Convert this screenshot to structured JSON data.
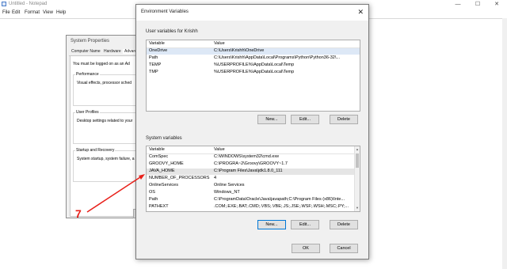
{
  "notepad": {
    "title": "Untitled - Notepad",
    "menu": [
      "File",
      "Edit",
      "Format",
      "View",
      "Help"
    ]
  },
  "system_properties": {
    "title": "System Properties",
    "tabs": [
      "Computer Name",
      "Hardware",
      "Advan"
    ],
    "note": "You must be logged on as an Ad",
    "groups": [
      {
        "heading": "Performance",
        "desc": "Visual effects, processor sched"
      },
      {
        "heading": "User Profiles",
        "desc": "Desktop settings related to your"
      },
      {
        "heading": "Startup and Recovery",
        "desc": "System startup, system failure, a"
      }
    ],
    "ok": "OK"
  },
  "env": {
    "title": "Environment Variables",
    "close": "✕",
    "user_label": "User variables for Krishh",
    "columns": [
      "Variable",
      "Value"
    ],
    "user_rows": [
      {
        "var": "OneDrive",
        "val": "C:\\Users\\Krishh\\OneDrive"
      },
      {
        "var": "Path",
        "val": "C:\\Users\\Krishh\\AppData\\Local\\Programs\\Python\\Python36-32\\..."
      },
      {
        "var": "TEMP",
        "val": "%USERPROFILE%\\AppData\\Local\\Temp"
      },
      {
        "var": "TMP",
        "val": "%USERPROFILE%\\AppData\\Local\\Temp"
      }
    ],
    "user_buttons": [
      "New...",
      "Edit...",
      "Delete"
    ],
    "system_label": "System variables",
    "system_rows": [
      {
        "var": "ComSpec",
        "val": "C:\\WINDOWS\\system32\\cmd.exe"
      },
      {
        "var": "GROOVY_HOME",
        "val": "C:\\PROGRA~2\\Groovy\\GROOVY~1.7"
      },
      {
        "var": "JAVA_HOME",
        "val": "C:\\Program Files\\Java\\jdk1.8.0_111"
      },
      {
        "var": "NUMBER_OF_PROCESSORS",
        "val": "4"
      },
      {
        "var": "OnlineServices",
        "val": "Online Services"
      },
      {
        "var": "OS",
        "val": "Windows_NT"
      },
      {
        "var": "Path",
        "val": "C:\\ProgramData\\Oracle\\Java\\javapath;C:\\Program Files (x86)\\Inte..."
      },
      {
        "var": "PATHEXT",
        "val": ".COM;.EXE;.BAT;.CMD;.VBS;.VBE;.JS;.JSE;.WSF;.WSH;.MSC;.PY;..."
      }
    ],
    "system_buttons": [
      "New...",
      "Edit...",
      "Delete"
    ],
    "ok": "OK",
    "cancel": "Cancel"
  },
  "annotation": {
    "number": "7",
    "color": "#e8201a"
  }
}
